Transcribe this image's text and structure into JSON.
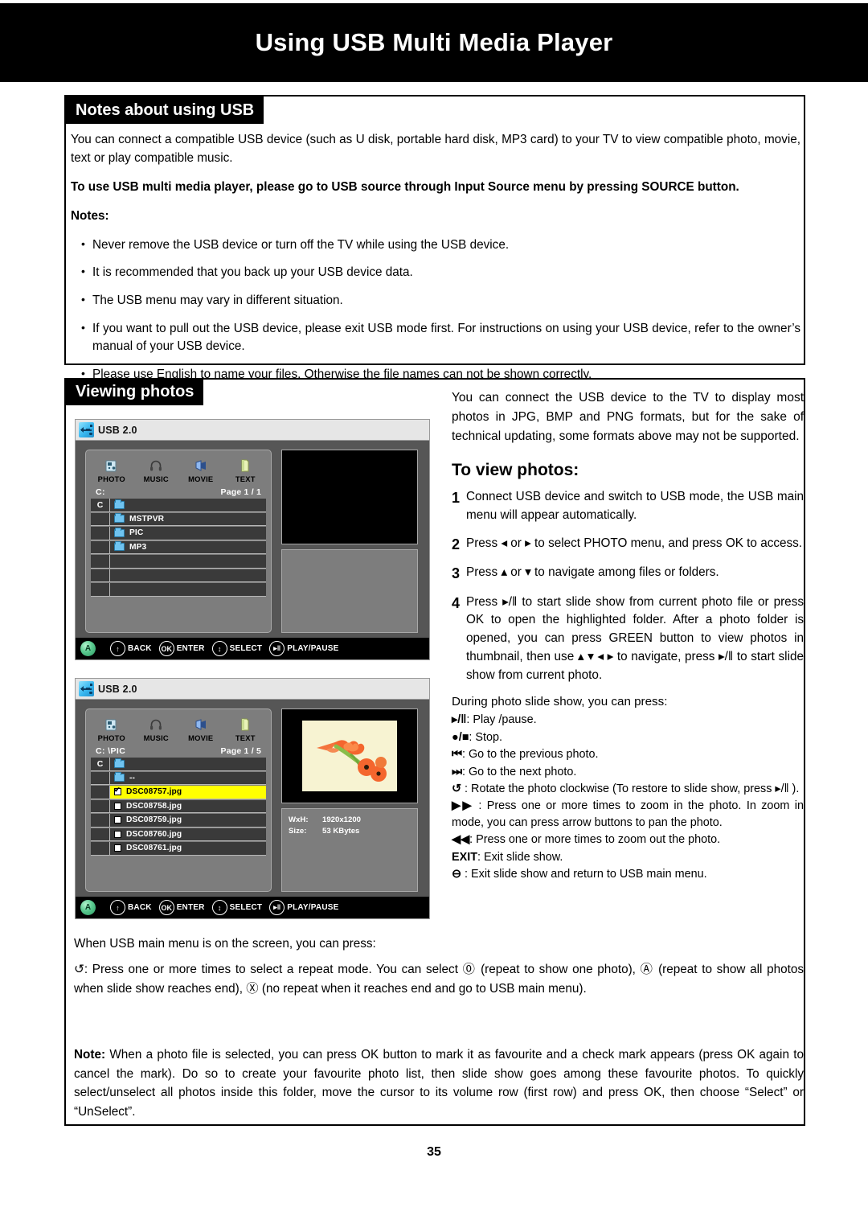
{
  "header": {
    "title": "Using USB Multi Media Player"
  },
  "notes_panel": {
    "tab_label": "Notes about using USB",
    "intro": "You can connect a compatible USB device (such as U disk, portable hard disk, MP3 card) to your TV to view compatible photo, movie, text or play compatible music.",
    "bold_note": "To use USB multi media player, please go to USB source through Input Source menu by pressing SOURCE button.",
    "notes_label": "Notes:",
    "bullets": [
      "Never remove the USB device or turn off the TV while using the USB device.",
      "It is recommended that you back up your USB device data.",
      "The USB menu may vary in different situation.",
      "If you want to pull out the USB device, please exit USB mode first.  For instructions on using your USB device, refer to the owner’s manual of your USB device.",
      "Please use English to name your files. Otherwise the file names can not be shown correctly."
    ]
  },
  "viewing_panel": {
    "tab_label": "Viewing photos",
    "intro": "You can connect the USB device to the TV to display most photos in JPG, BMP and PNG formats, but for the sake of technical updating, some formats above may not be supported.",
    "to_view_heading": "To view photos:",
    "steps": [
      {
        "num": "1",
        "text": "Connect USB device and switch to USB mode, the USB main menu will appear automatically."
      },
      {
        "num": "2",
        "text": "Press ◂ or ▸ to select PHOTO menu, and press OK to access."
      },
      {
        "num": "3",
        "text": "Press ▴ or ▾ to navigate among files or folders."
      },
      {
        "num": "4",
        "text": "Press ▸/‖ to start slide show from current photo file or press OK to open the highlighted folder. After a photo folder is opened, you can press GREEN button to view photos in thumbnail, then use ▴ ▾ ◂ ▸ to navigate, press ▸/‖ to start slide show from current photo."
      }
    ],
    "during_label": "During photo slide show, you can press:",
    "keys": [
      {
        "key": "▸/‖",
        "desc": ":  Play /pause."
      },
      {
        "key": "●/■",
        "desc": ":  Stop."
      },
      {
        "key": "⏮",
        "desc": ":  Go to the previous photo."
      },
      {
        "key": "⏭",
        "desc": ":  Go to the next photo."
      },
      {
        "key": "↺",
        "desc": " : Rotate the photo clockwise (To restore to slide show, press ▸/‖ )."
      },
      {
        "key": "▶▶",
        "desc": " : Press one or more times to zoom in the photo.  In zoom in mode, you can press arrow buttons to pan the photo."
      },
      {
        "key": "◀◀",
        "desc": ":  Press one or more times to zoom out the photo."
      },
      {
        "key": "EXIT",
        "desc": ": Exit slide show."
      },
      {
        "key": "⊖",
        "desc": " : Exit slide show and return to USB main menu."
      }
    ]
  },
  "bottom_text": {
    "line1": "When USB main menu is on the screen, you can press:",
    "line2_pre": "↺: Press one or more times to select a repeat mode. You can select ",
    "icon_one": "⓪",
    "line2_mid": " (repeat to show one photo), ",
    "icon_all": "Ⓐ",
    "line2_mid2": " (repeat to show all photos when slide show reaches end), ",
    "icon_none": "Ⓧ",
    "line2_end": " (no repeat when it reaches end and go to USB main menu)."
  },
  "note_box": {
    "label": "Note:",
    "text": " When a photo file is selected, you can press OK button to mark it as favourite and a check mark appears (press OK again to cancel the mark). Do so to create your favourite photo list, then slide show goes among these favourite photos. To quickly select/unselect all photos inside this folder, move the cursor to its volume row (first row) and press OK, then choose “Select” or “UnSelect”."
  },
  "page_number": "35",
  "tv_screen_1": {
    "title": "USB 2.0",
    "media_tabs": [
      {
        "label": "PHOTO",
        "icon": "photo-icon"
      },
      {
        "label": "MUSIC",
        "icon": "headphones-icon"
      },
      {
        "label": "MOVIE",
        "icon": "movie-icon"
      },
      {
        "label": "TEXT",
        "icon": "text-document-icon"
      }
    ],
    "path": "C:",
    "page": "Page 1 / 1",
    "rows": [
      {
        "drive": "C",
        "name": "",
        "type": "folder"
      },
      {
        "drive": "",
        "name": "MSTPVR",
        "type": "folder"
      },
      {
        "drive": "",
        "name": "PIC",
        "type": "folder"
      },
      {
        "drive": "",
        "name": "MP3",
        "type": "folder"
      },
      {
        "drive": "",
        "name": "",
        "type": "empty"
      },
      {
        "drive": "",
        "name": "",
        "type": "empty"
      },
      {
        "drive": "",
        "name": "",
        "type": "empty"
      }
    ],
    "footer": [
      {
        "glyph": "↑",
        "label": "BACK"
      },
      {
        "glyph": "OK",
        "label": "ENTER"
      },
      {
        "glyph": "↕",
        "label": "SELECT"
      },
      {
        "glyph": "▸‖",
        "label": "PLAY/PAUSE"
      }
    ]
  },
  "tv_screen_2": {
    "title": "USB 2.0",
    "media_tabs": [
      {
        "label": "PHOTO",
        "icon": "photo-icon"
      },
      {
        "label": "MUSIC",
        "icon": "headphones-icon"
      },
      {
        "label": "MOVIE",
        "icon": "movie-icon"
      },
      {
        "label": "TEXT",
        "icon": "text-document-icon"
      }
    ],
    "path": "C:  \\PIC",
    "page": "Page 1 / 5",
    "rows": [
      {
        "drive": "C",
        "name": "",
        "type": "folder",
        "selected": false
      },
      {
        "drive": "",
        "name": "--",
        "type": "folder",
        "selected": false
      },
      {
        "drive": "",
        "name": "DSC08757.jpg",
        "type": "file",
        "checked": true,
        "selected": true
      },
      {
        "drive": "",
        "name": "DSC08758.jpg",
        "type": "file",
        "checked": false,
        "selected": false
      },
      {
        "drive": "",
        "name": "DSC08759.jpg",
        "type": "file",
        "checked": false,
        "selected": false
      },
      {
        "drive": "",
        "name": "DSC08760.jpg",
        "type": "file",
        "checked": false,
        "selected": false
      },
      {
        "drive": "",
        "name": "DSC08761.jpg",
        "type": "file",
        "checked": false,
        "selected": false
      }
    ],
    "info": {
      "wxh_label": "WxH:",
      "wxh_value": "1920x1200",
      "size_label": "Size:",
      "size_value": "53 KBytes"
    },
    "footer": [
      {
        "glyph": "↑",
        "label": "BACK"
      },
      {
        "glyph": "OK",
        "label": "ENTER"
      },
      {
        "glyph": "↕",
        "label": "SELECT"
      },
      {
        "glyph": "▸‖",
        "label": "PLAY/PAUSE"
      }
    ]
  },
  "colors": {
    "highlight": "#ffff00",
    "panel_gray": "#7d7d7d",
    "body_gray": "#565656",
    "row_dark": "#3a3a3a",
    "folder_blue": "#6fc3f0",
    "green_button": "#59c98f"
  }
}
